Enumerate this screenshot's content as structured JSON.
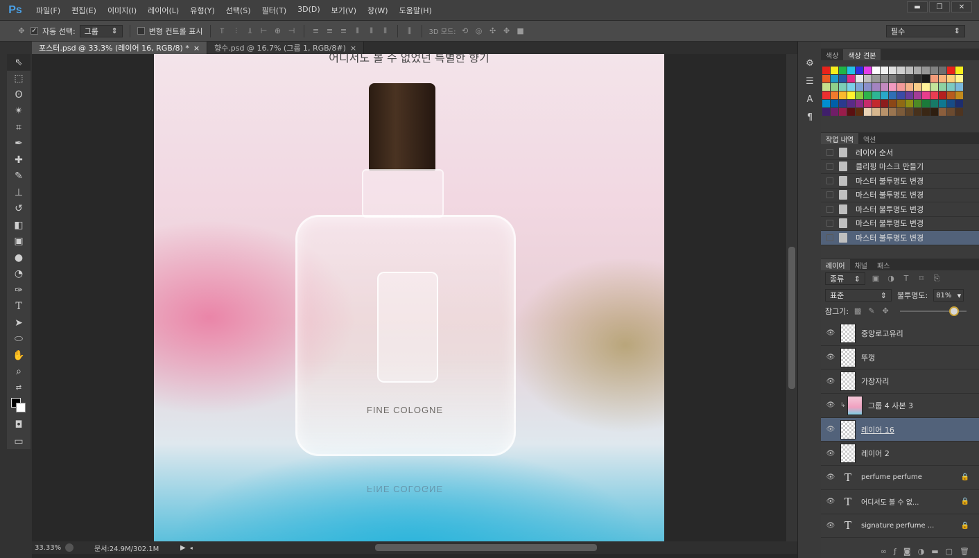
{
  "app": {
    "logo": "Ps",
    "menu": [
      "파일(F)",
      "편집(E)",
      "이미지(I)",
      "레이어(L)",
      "유형(Y)",
      "선택(S)",
      "필터(T)",
      "3D(D)",
      "보기(V)",
      "창(W)",
      "도움말(H)"
    ],
    "window_controls": [
      "▬",
      "❐",
      "✕"
    ]
  },
  "options": {
    "auto_select_label": "자동 선택:",
    "auto_select_value": "그룹",
    "transform_controls_label": "변형 컨트롤 표시",
    "mode_3d_label": "3D 모드:",
    "workspace": "필수"
  },
  "tabs": [
    {
      "label": "포스터.psd @ 33.3% (레이어 16, RGB/8) *",
      "close": "×"
    },
    {
      "label": "향수.psd @ 16.7% (그룹 1, RGB/8#)",
      "close": "×"
    }
  ],
  "canvas": {
    "headline": "어디서도 볼 수 없었던 특별한 향기",
    "bottle_label": "FINE COLOGNE",
    "reflection_label": "FINE COLOGNE"
  },
  "status": {
    "zoom": "33.33%",
    "doc": "문서:24.9M/302.1M"
  },
  "swatches_panel": {
    "tabs": [
      "색상",
      "색상 견본"
    ],
    "colors": [
      "#e8231b",
      "#f7ee1c",
      "#1fb548",
      "#22c1e8",
      "#2f2fe0",
      "#e43de8",
      "#ffffff",
      "#f2f2f2",
      "#e0e0e0",
      "#cfcfcf",
      "#bdbdbd",
      "#aaaaaa",
      "#969696",
      "#828282",
      "#6e6e6e",
      "#e8231b",
      "#f7ee1c",
      "#ea5a23",
      "#1f9ac9",
      "#2457a6",
      "#e02a86",
      "#e8e8e8",
      "#bfbfbf",
      "#999999",
      "#8a8a8a",
      "#777777",
      "#555555",
      "#444444",
      "#2f2f2f",
      "#1a1a1a",
      "#f39b7a",
      "#f6b27c",
      "#fbcf7b",
      "#fff48f",
      "#c6df8b",
      "#8fd08a",
      "#7ccdb6",
      "#7cd0e8",
      "#7fa4d6",
      "#8a8fcb",
      "#a384c1",
      "#c48ac0",
      "#f19ac0",
      "#f29a9a",
      "#f4b38a",
      "#f9cd89",
      "#fff39a",
      "#c3e39a",
      "#8dd1a2",
      "#7cc9c2",
      "#7ab8dc",
      "#ec2f2f",
      "#f27a2d",
      "#fbb92e",
      "#fff22e",
      "#8ccc3d",
      "#2eb34b",
      "#2db594",
      "#2aa7c9",
      "#2f6fb5",
      "#3b4ba6",
      "#6a3c9a",
      "#a23c97",
      "#e83c8c",
      "#e93e52",
      "#b4201f",
      "#b85b1e",
      "#c28a1c",
      "#008fd0",
      "#005fa8",
      "#2a3a8f",
      "#5a2b87",
      "#8c2a86",
      "#c72b6a",
      "#c3282e",
      "#8d1d1d",
      "#8c4716",
      "#8f6a14",
      "#8f8f14",
      "#4d8a25",
      "#1b7a3a",
      "#177a67",
      "#0f7891",
      "#174b86",
      "#1d2d6e",
      "#3f1f6b",
      "#701e68",
      "#9a1c4b",
      "#5a1010",
      "#5c2e0e",
      "#ead3b5",
      "#d7b78e",
      "#b8926a",
      "#9a7550",
      "#7c5b3a",
      "#5f4428",
      "#47311c",
      "#3a2715",
      "#2e1e10",
      "#8b5e3c",
      "#6b4a2f",
      "#4e3420"
    ]
  },
  "history_panel": {
    "tabs": [
      "작업 내역",
      "액션"
    ],
    "items": [
      "레이어 순서",
      "클리핑 마스크 만들기",
      "마스터 불투명도 변경",
      "마스터 불투명도 변경",
      "마스터 불투명도 변경",
      "마스터 불투명도 변경",
      "마스터 불투명도 변경"
    ],
    "selected_index": 6
  },
  "layers_panel": {
    "tabs": [
      "레이어",
      "채널",
      "패스"
    ],
    "filter": "종류",
    "blend_mode": "표준",
    "opacity_label": "불투명도:",
    "opacity_value": "81%",
    "opacity_fraction": 0.81,
    "lock_label": "잠그기:",
    "layers": [
      {
        "name": "중앙로고유리",
        "kind": "pixel",
        "selected": false,
        "locked": false
      },
      {
        "name": "뚜껑",
        "kind": "pixel",
        "selected": false,
        "locked": false
      },
      {
        "name": "가장자리",
        "kind": "pixel",
        "selected": false,
        "locked": false
      },
      {
        "name": "그룹 4 사본 3",
        "kind": "photo",
        "selected": false,
        "locked": false
      },
      {
        "name": "레이어 16",
        "kind": "pixel",
        "selected": true,
        "locked": false
      },
      {
        "name": "레이어 2",
        "kind": "pixel",
        "selected": false,
        "locked": false
      },
      {
        "name": "perfume perfume",
        "kind": "type",
        "selected": false,
        "locked": true
      },
      {
        "name": "어디서도 볼 수 없...",
        "kind": "type",
        "selected": false,
        "locked": true
      },
      {
        "name": "signature perfume ...",
        "kind": "type",
        "selected": false,
        "locked": true
      }
    ]
  }
}
